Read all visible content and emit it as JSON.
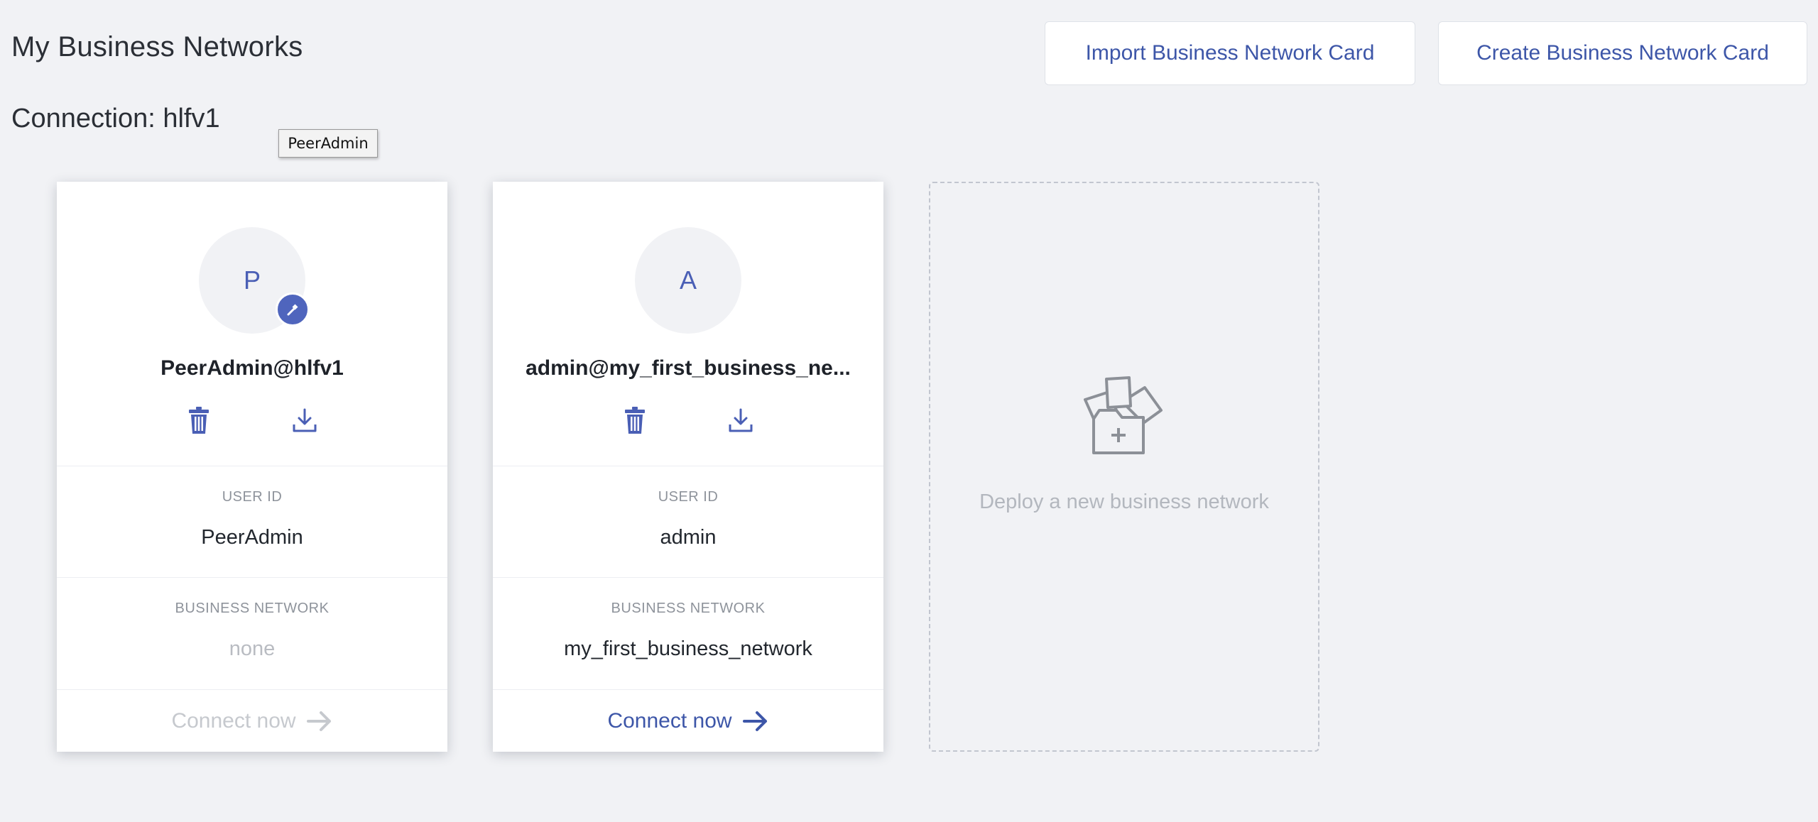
{
  "header": {
    "title": "My Business Networks",
    "connection_title": "Connection: hlfv1",
    "import_button": "Import Business Network Card",
    "create_button": "Create Business Network Card"
  },
  "tooltip": {
    "text": "PeerAdmin"
  },
  "cards": [
    {
      "avatar_letter": "P",
      "name": "PeerAdmin@hlfv1",
      "user_id_label": "USER ID",
      "user_id": "PeerAdmin",
      "network_label": "BUSINESS NETWORK",
      "network": "none",
      "connect_label": "Connect now",
      "connect_enabled": false,
      "badge": "hammer-icon"
    },
    {
      "avatar_letter": "A",
      "name": "admin@my_first_business_ne...",
      "user_id_label": "USER ID",
      "user_id": "admin",
      "network_label": "BUSINESS NETWORK",
      "network": "my_first_business_network",
      "connect_label": "Connect now",
      "connect_enabled": true
    }
  ],
  "deploy": {
    "label": "Deploy a new business network",
    "icon": "deploy-network-icon"
  },
  "colors": {
    "accent": "#3d56a8",
    "badge": "#4f65bd",
    "background": "#f1f2f5",
    "muted_text": "#b9bcc2"
  }
}
